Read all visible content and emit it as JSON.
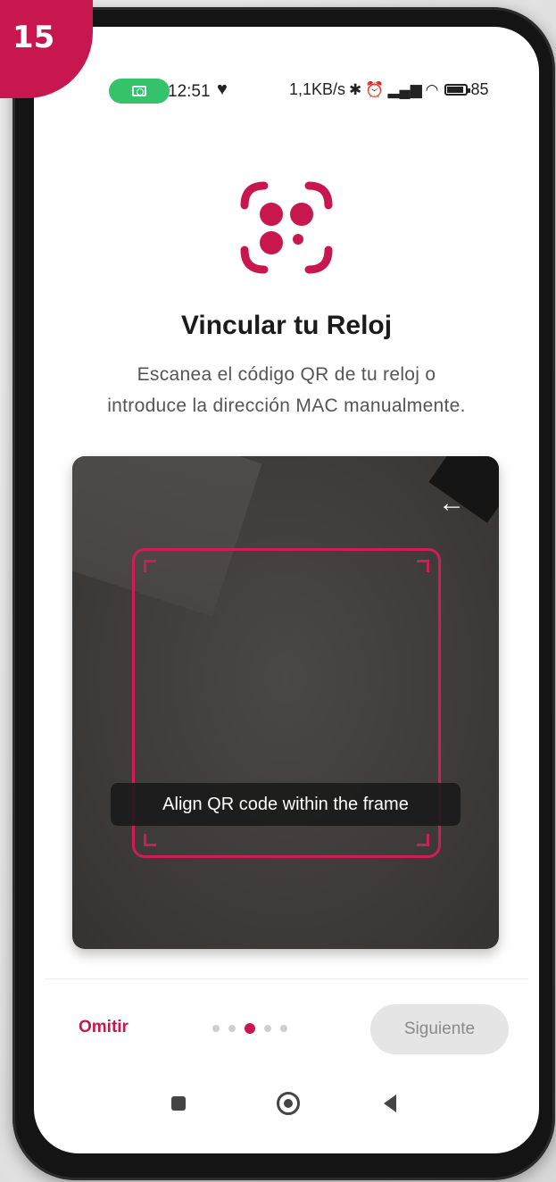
{
  "badge": {
    "number": "15"
  },
  "status_bar": {
    "time": "12:51",
    "network_speed": "1,1KB/s",
    "battery_percent": "85"
  },
  "header": {
    "title": "Vincular tu Reloj",
    "subtitle_line1": "Escanea el código QR de tu reloj o",
    "subtitle_line2": "introduce la dirección MAC manualmente."
  },
  "scanner": {
    "hint": "Align QR code within the frame",
    "back_glyph": "←"
  },
  "footer": {
    "skip_label": "Omitir",
    "next_label": "Siguiente",
    "page_total": 5,
    "page_current": 3
  },
  "colors": {
    "accent": "#c8174f",
    "status_green": "#34c26a"
  },
  "icons": [
    "camera-icon",
    "heart-icon",
    "bluetooth-icon",
    "alarm-icon",
    "signal-icon",
    "wifi-icon",
    "battery-icon",
    "scan-face-icon",
    "back-arrow-icon",
    "recent-apps-icon",
    "home-icon",
    "nav-back-icon"
  ]
}
